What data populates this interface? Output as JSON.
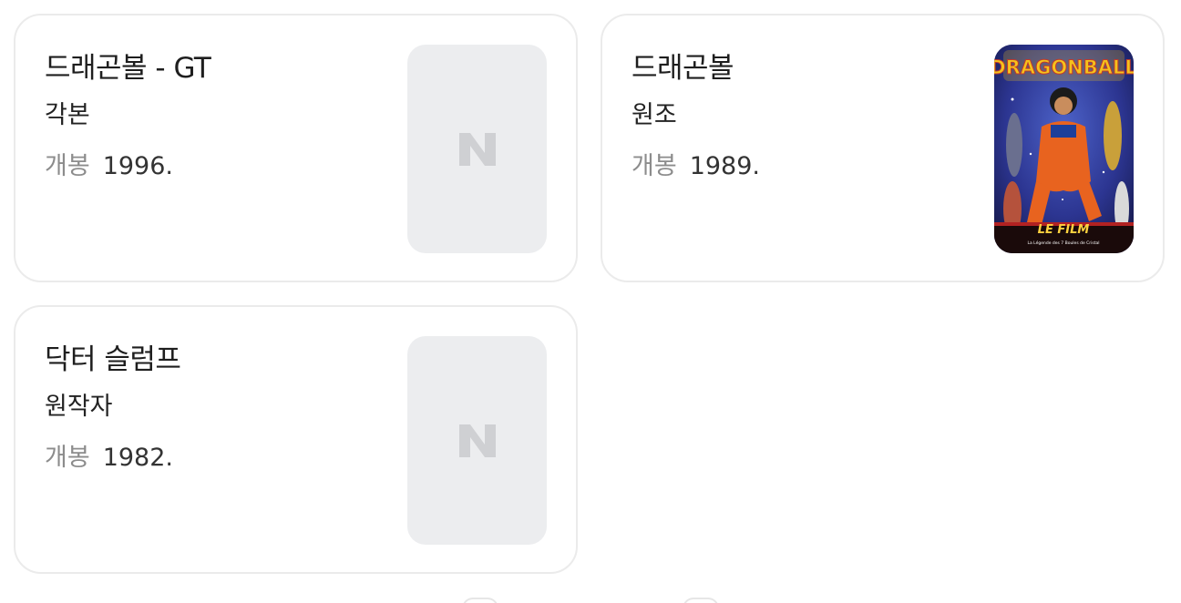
{
  "cards": [
    {
      "title": "드래곤볼 - GT",
      "role": "각본",
      "meta_key": "개봉",
      "meta_value": "1996.",
      "thumbnail": "placeholder",
      "placeholder_letter": "N"
    },
    {
      "title": "드래곤볼",
      "role": "원조",
      "meta_key": "개봉",
      "meta_value": "1989.",
      "thumbnail": "poster",
      "poster_logo": "DRAGONBALL",
      "poster_caption": "LE FILM",
      "poster_subcaption": "La Légende des 7 Boules de Cristal"
    },
    {
      "title": "닥터 슬럼프",
      "role": "원작자",
      "meta_key": "개봉",
      "meta_value": "1982.",
      "thumbnail": "placeholder",
      "placeholder_letter": "N"
    }
  ],
  "colors": {
    "border": "#ebebeb",
    "placeholder_bg": "#ecedef",
    "placeholder_letter": "#cfd0d3",
    "meta_key": "#8c8c8c"
  }
}
